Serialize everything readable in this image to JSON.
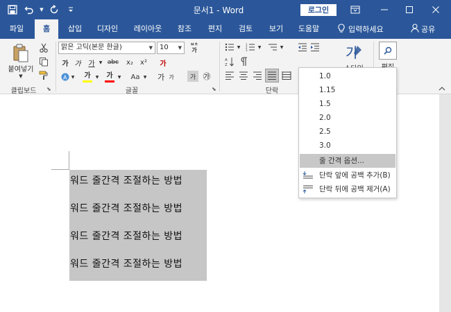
{
  "app": {
    "document_name": "문서1",
    "app_name": "Word",
    "title_separator": " - "
  },
  "titlebar": {
    "login_label": "로그인"
  },
  "tabs": [
    {
      "label": "파일"
    },
    {
      "label": "홈"
    },
    {
      "label": "삽입"
    },
    {
      "label": "디자인"
    },
    {
      "label": "레이아웃"
    },
    {
      "label": "참조"
    },
    {
      "label": "편지"
    },
    {
      "label": "검토"
    },
    {
      "label": "보기"
    },
    {
      "label": "도움말"
    }
  ],
  "tell_me": {
    "label": "입력하세요"
  },
  "share": {
    "label": "공유"
  },
  "ribbon": {
    "clipboard": {
      "label": "클립보드",
      "paste_label": "붙여넣기"
    },
    "font": {
      "label": "글꼴",
      "font_name": "맑은 고딕(본문 한글)",
      "font_size": "10",
      "grow_label": "가",
      "shrink_label": "가",
      "case_label": "Aa",
      "bold": "가",
      "italic": "가",
      "underline": "가",
      "strike": "abc",
      "subscript": "x₂",
      "superscript": "x²",
      "highlight": "가",
      "font_color": "가",
      "char_shade": "가",
      "enclose": "㉮",
      "phonetic": "가"
    },
    "paragraph": {
      "label": "단락"
    },
    "styles": {
      "label": "스타일"
    },
    "editing": {
      "label": "편집"
    }
  },
  "document": {
    "lines": [
      "워드 줄간격 조절하는 방법",
      "워드 줄간격 조절하는 방법",
      "워드 줄간격 조절하는 방법",
      "워드 줄간격 조절하는 방법"
    ]
  },
  "line_spacing_menu": {
    "options": [
      "1.0",
      "1.15",
      "1.5",
      "2.0",
      "2.5",
      "3.0"
    ],
    "spacing_options": "줄 간격 옵션...",
    "add_space_before": "단락 앞에 공백 추가(B)",
    "remove_space_after": "단락 뒤에 공백 제거(A)"
  },
  "colors": {
    "title_bar": "#2b579a",
    "ribbon_bg": "#f3f3f3",
    "selection": "#c6c6c6",
    "highlight_yellow": "#ffff00",
    "font_red": "#ff0000",
    "menu_hover": "#c8c8c8"
  }
}
